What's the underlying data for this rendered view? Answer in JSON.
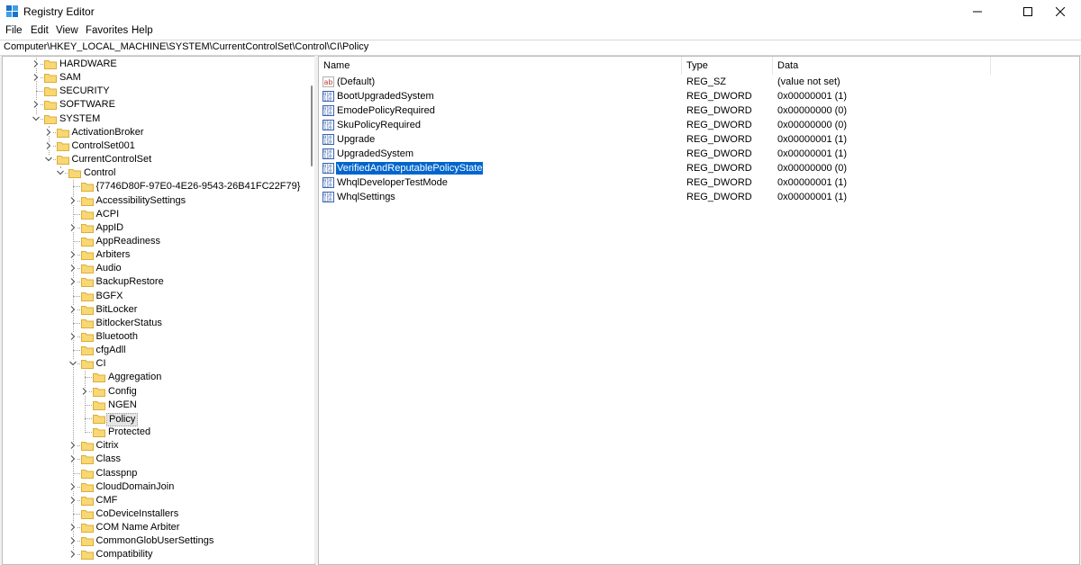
{
  "window": {
    "title": "Registry Editor"
  },
  "menu": {
    "items": [
      "File",
      "Edit",
      "View",
      "Favorites",
      "Help"
    ]
  },
  "address": {
    "path": "Computer\\HKEY_LOCAL_MACHINE\\SYSTEM\\CurrentControlSet\\Control\\CI\\Policy"
  },
  "tree": {
    "items": [
      {
        "label": "HARDWARE",
        "level": 0,
        "expander": "collapsed"
      },
      {
        "label": "SAM",
        "level": 0,
        "expander": "collapsed"
      },
      {
        "label": "SECURITY",
        "level": 0,
        "expander": "none"
      },
      {
        "label": "SOFTWARE",
        "level": 0,
        "expander": "collapsed"
      },
      {
        "label": "SYSTEM",
        "level": 0,
        "expander": "expanded"
      },
      {
        "label": "ActivationBroker",
        "level": 1,
        "expander": "collapsed"
      },
      {
        "label": "ControlSet001",
        "level": 1,
        "expander": "collapsed"
      },
      {
        "label": "CurrentControlSet",
        "level": 1,
        "expander": "expanded"
      },
      {
        "label": "Control",
        "level": 2,
        "expander": "expanded"
      },
      {
        "label": "{7746D80F-97E0-4E26-9543-26B41FC22F79}",
        "level": 3,
        "expander": "none"
      },
      {
        "label": "AccessibilitySettings",
        "level": 3,
        "expander": "collapsed"
      },
      {
        "label": "ACPI",
        "level": 3,
        "expander": "none"
      },
      {
        "label": "AppID",
        "level": 3,
        "expander": "collapsed"
      },
      {
        "label": "AppReadiness",
        "level": 3,
        "expander": "none"
      },
      {
        "label": "Arbiters",
        "level": 3,
        "expander": "collapsed"
      },
      {
        "label": "Audio",
        "level": 3,
        "expander": "collapsed"
      },
      {
        "label": "BackupRestore",
        "level": 3,
        "expander": "collapsed"
      },
      {
        "label": "BGFX",
        "level": 3,
        "expander": "none"
      },
      {
        "label": "BitLocker",
        "level": 3,
        "expander": "collapsed"
      },
      {
        "label": "BitlockerStatus",
        "level": 3,
        "expander": "none"
      },
      {
        "label": "Bluetooth",
        "level": 3,
        "expander": "collapsed"
      },
      {
        "label": "cfgAdll",
        "level": 3,
        "expander": "none"
      },
      {
        "label": "CI",
        "level": 3,
        "expander": "expanded"
      },
      {
        "label": "Aggregation",
        "level": 4,
        "expander": "none"
      },
      {
        "label": "Config",
        "level": 4,
        "expander": "collapsed"
      },
      {
        "label": "NGEN",
        "level": 4,
        "expander": "none"
      },
      {
        "label": "Policy",
        "level": 4,
        "expander": "none",
        "selected": true
      },
      {
        "label": "Protected",
        "level": 4,
        "expander": "none"
      },
      {
        "label": "Citrix",
        "level": 3,
        "expander": "collapsed"
      },
      {
        "label": "Class",
        "level": 3,
        "expander": "collapsed"
      },
      {
        "label": "Classpnp",
        "level": 3,
        "expander": "none"
      },
      {
        "label": "CloudDomainJoin",
        "level": 3,
        "expander": "collapsed"
      },
      {
        "label": "CMF",
        "level": 3,
        "expander": "collapsed"
      },
      {
        "label": "CoDeviceInstallers",
        "level": 3,
        "expander": "none"
      },
      {
        "label": "COM Name Arbiter",
        "level": 3,
        "expander": "collapsed"
      },
      {
        "label": "CommonGlobUserSettings",
        "level": 3,
        "expander": "collapsed"
      },
      {
        "label": "Compatibility",
        "level": 3,
        "expander": "collapsed"
      }
    ]
  },
  "list": {
    "columns": [
      "Name",
      "Type",
      "Data"
    ],
    "rows": [
      {
        "icon": "string-value-icon",
        "name": "(Default)",
        "type": "REG_SZ",
        "data": "(value not set)"
      },
      {
        "icon": "binary-value-icon",
        "name": "BootUpgradedSystem",
        "type": "REG_DWORD",
        "data": "0x00000001 (1)"
      },
      {
        "icon": "binary-value-icon",
        "name": "EmodePolicyRequired",
        "type": "REG_DWORD",
        "data": "0x00000000 (0)"
      },
      {
        "icon": "binary-value-icon",
        "name": "SkuPolicyRequired",
        "type": "REG_DWORD",
        "data": "0x00000000 (0)"
      },
      {
        "icon": "binary-value-icon",
        "name": "Upgrade",
        "type": "REG_DWORD",
        "data": "0x00000001 (1)"
      },
      {
        "icon": "binary-value-icon",
        "name": "UpgradedSystem",
        "type": "REG_DWORD",
        "data": "0x00000001 (1)"
      },
      {
        "icon": "binary-value-icon",
        "name": "VerifiedAndReputablePolicyState",
        "type": "REG_DWORD",
        "data": "0x00000000 (0)",
        "selected": true
      },
      {
        "icon": "binary-value-icon",
        "name": "WhqlDeveloperTestMode",
        "type": "REG_DWORD",
        "data": "0x00000001 (1)"
      },
      {
        "icon": "binary-value-icon",
        "name": "WhqlSettings",
        "type": "REG_DWORD",
        "data": "0x00000001 (1)"
      }
    ]
  },
  "colors": {
    "selection": "#0066cc",
    "folder": "#f8d775",
    "folder_edge": "#dcae36"
  }
}
